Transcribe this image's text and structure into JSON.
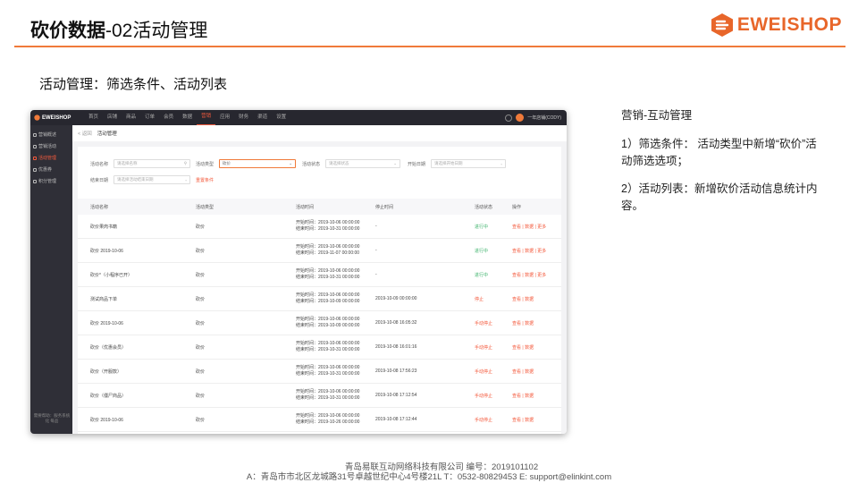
{
  "slide": {
    "title_bold": "砍价数据",
    "title_rest": "-02活动管理",
    "brand": "EWEISHOP",
    "section_heading": "活动管理：筛选条件、活动列表",
    "accent_color": "#f07a3a"
  },
  "notes": {
    "heading": "营销-互动管理",
    "p1": "1）筛选条件： 活动类型中新增“砍价”活动筛选选项；",
    "p2": "2）活动列表：新增砍价活动信息统计内容。"
  },
  "footer": {
    "line1": "青岛易联互动网络科技有限公司    编号：2019101102",
    "line2": "A：青岛市市北区龙城路31号卓越世纪中心4号楼21L    T：0532-80829453    E: support@elinkint.com"
  },
  "app": {
    "logo": "EWEISHOP",
    "nav": [
      "首页",
      "店铺",
      "商品",
      "订单",
      "会员",
      "数据",
      "营销",
      "应用",
      "财务",
      "渠道",
      "设置"
    ],
    "nav_active": 6,
    "shop_name": "一年店铺(CODY)",
    "sidebar": [
      {
        "label": "营销概述",
        "active": false
      },
      {
        "label": "营销活动",
        "active": false
      },
      {
        "label": "活动管理",
        "active": true
      },
      {
        "label": "优惠券",
        "active": false
      },
      {
        "label": "积分管理",
        "active": false
      }
    ],
    "sidebar_footer": "需要帮助：服务系统化 每品",
    "breadcrumb_back": "< 返回",
    "breadcrumb_current": "活动管理",
    "filters": {
      "name_label": "活动名称",
      "name_placeholder": "请选择名称",
      "type_label": "活动类型",
      "type_value": "砍价",
      "status_label": "活动状态",
      "status_placeholder": "请选择状态",
      "start_label": "开始日期",
      "start_placeholder": "请选择开始日期",
      "end_label": "结束日期",
      "end_placeholder": "请选择活动结束日期",
      "reset": "重置条件"
    },
    "table": {
      "headers": [
        "活动名称",
        "活动类型",
        "活动时间",
        "停止时间",
        "活动状态",
        "操作"
      ],
      "rows": [
        {
          "name": "砍价果肉书籍",
          "type": "砍价",
          "start": "开始时间：2019-10-06 00:00:00",
          "end": "结束时间：2019-10-31 00:00:00",
          "stop": "-",
          "status": "进行中",
          "status_kind": "green",
          "ops": "查看 | 数据 | 更多"
        },
        {
          "name": "砍价 2019-10-06",
          "type": "砍价",
          "start": "开始时间：2019-10-06 00:00:00",
          "end": "结束时间：2019-11-07 00:00:00",
          "stop": "-",
          "status": "进行中",
          "status_kind": "green",
          "ops": "查看 | 数据 | 更多"
        },
        {
          "name": "砍价*（小程序已开）",
          "type": "砍价",
          "start": "开始时间：2019-10-06 00:00:00",
          "end": "结束时间：2019-10-31 00:00:00",
          "stop": "-",
          "status": "进行中",
          "status_kind": "green",
          "ops": "查看 | 数据 | 更多"
        },
        {
          "name": "测试商品下单",
          "type": "砍价",
          "start": "开始时间：2019-10-06 00:00:00",
          "end": "结束时间：2019-10-09 00:00:00",
          "stop": "2019-10-09 00:00:00",
          "status": "停止",
          "status_kind": "red",
          "ops": "查看 | 数据"
        },
        {
          "name": "砍价 2019-10-06",
          "type": "砍价",
          "start": "开始时间：2019-10-06 00:00:00",
          "end": "结束时间：2019-10-09 00:00:00",
          "stop": "2019-10-08 16:05:32",
          "status": "手动停止",
          "status_kind": "red",
          "ops": "查看 | 数据"
        },
        {
          "name": "砍价（优惠会员）",
          "type": "砍价",
          "start": "开始时间：2019-10-06 00:00:00",
          "end": "结束时间：2019-10-31 00:00:00",
          "stop": "2019-10-08 16:01:16",
          "status": "手动停止",
          "status_kind": "red",
          "ops": "查看 | 数据"
        },
        {
          "name": "砍价（开服款）",
          "type": "砍价",
          "start": "开始时间：2019-10-06 00:00:00",
          "end": "结束时间：2019-10-31 00:00:00",
          "stop": "2019-10-08 17:56:23",
          "status": "手动停止",
          "status_kind": "red",
          "ops": "查看 | 数据"
        },
        {
          "name": "砍价（僵尸商品）",
          "type": "砍价",
          "start": "开始时间：2019-10-06 00:00:00",
          "end": "结束时间：2019-10-31 00:00:00",
          "stop": "2019-10-08 17:12:54",
          "status": "手动停止",
          "status_kind": "red",
          "ops": "查看 | 数据"
        },
        {
          "name": "砍价 2019-10-06",
          "type": "砍价",
          "start": "开始时间：2019-10-06 00:00:00",
          "end": "结束时间：2019-10-26 00:00:00",
          "stop": "2019-10-08 17:12:44",
          "status": "手动停止",
          "status_kind": "red",
          "ops": "查看 | 数据"
        }
      ]
    }
  }
}
